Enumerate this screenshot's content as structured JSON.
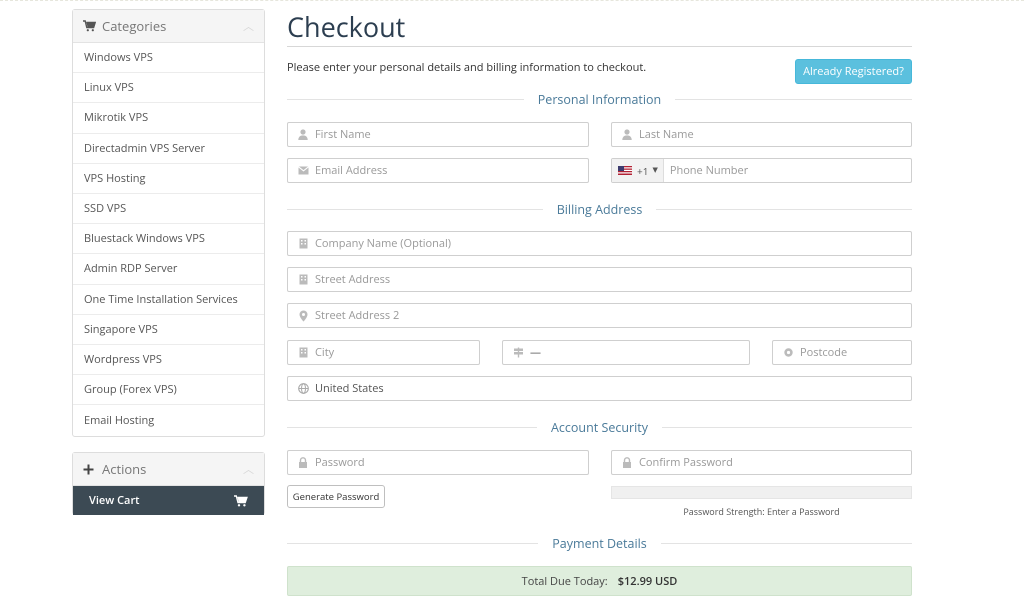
{
  "sidebar": {
    "categories_title": "Categories",
    "categories": [
      "Windows VPS",
      "Linux VPS",
      "Mikrotik VPS",
      "Directadmin VPS Server",
      "VPS Hosting",
      "SSD VPS",
      "Bluestack Windows VPS",
      "Admin RDP Server",
      "One Time Installation Services",
      "Singapore VPS",
      "Wordpress VPS",
      "Group (Forex VPS)",
      "Email Hosting"
    ],
    "actions_title": "Actions",
    "view_cart": "View Cart"
  },
  "main": {
    "title": "Checkout",
    "intro": "Please enter your personal details and billing information to checkout.",
    "already_registered": "Already Registered?",
    "sections": {
      "personal": "Personal Information",
      "billing": "Billing Address",
      "security": "Account Security",
      "payment": "Payment Details"
    },
    "fields": {
      "first_name": "First Name",
      "last_name": "Last Name",
      "email": "Email Address",
      "phone_code": "+1",
      "phone": "Phone Number",
      "company": "Company Name (Optional)",
      "street": "Street Address",
      "street2": "Street Address 2",
      "city": "City",
      "state": "—",
      "postcode": "Postcode",
      "country": "United States",
      "password": "Password",
      "confirm_password": "Confirm Password"
    },
    "generate_password": "Generate Password",
    "password_strength": "Password Strength: Enter a Password",
    "total_label": "Total Due Today:",
    "total_amount": "$12.99 USD"
  },
  "colors": {
    "accent": "#5bc0de",
    "heading": "#2c3e50",
    "section": "#4a7a99",
    "cart_bar": "#3c4a54",
    "total_bg": "#dfeedd"
  }
}
